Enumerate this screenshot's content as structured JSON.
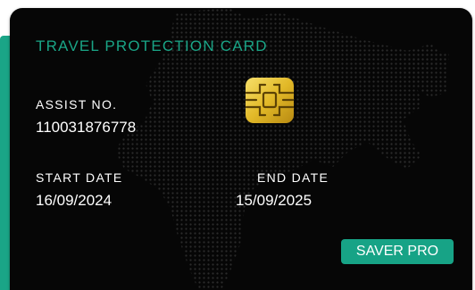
{
  "card": {
    "title": "TRAVEL PROTECTION CARD",
    "assist_label": "ASSIST NO.",
    "assist_number": "110031876778",
    "start_label": "START DATE",
    "start_date": "16/09/2024",
    "end_label": "END DATE",
    "end_date": "15/09/2025",
    "plan": "SAVER PRO",
    "chip_icon": "sim-chip-icon",
    "background_icon": "dotted-world-map-icon"
  },
  "colors": {
    "accent": "#1aa587",
    "card_background": "#060606",
    "text": "#ffffff",
    "chip_gold": "#e2b928",
    "map_dots": "#2a2a2a"
  }
}
